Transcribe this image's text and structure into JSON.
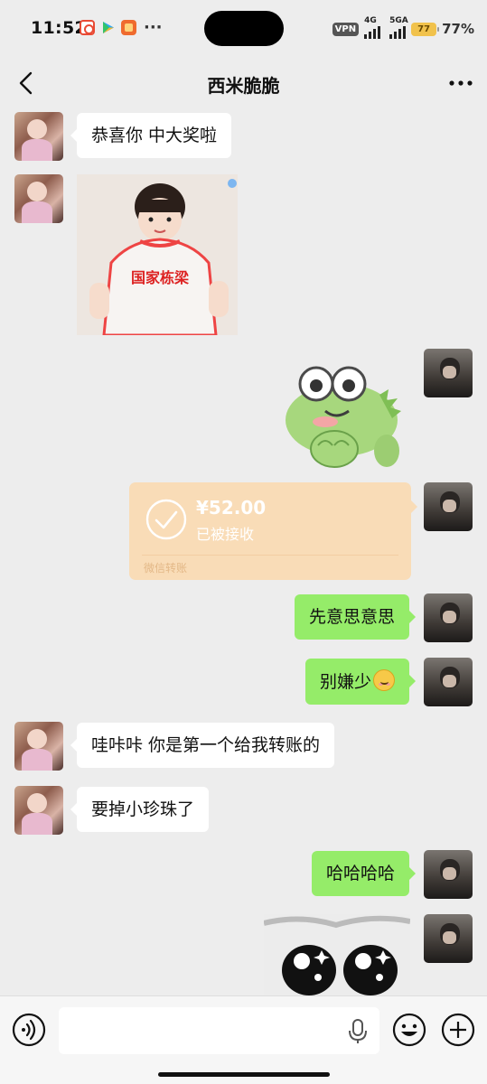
{
  "status_bar": {
    "time": "11:52",
    "more": "···",
    "vpn": "VPN",
    "net1": "4G",
    "net2": "5GA",
    "battery_level": "77",
    "battery_pct": "77%"
  },
  "nav": {
    "title": "西米脆脆"
  },
  "messages": [
    {
      "side": "left",
      "type": "text",
      "text": "恭喜你 中大奖啦"
    },
    {
      "side": "left",
      "type": "sticker",
      "sticker_text": "国家栋梁"
    },
    {
      "side": "right",
      "type": "sticker",
      "sticker": "frog"
    },
    {
      "side": "right",
      "type": "transfer",
      "amount": "¥52.00",
      "status": "已被接收",
      "brand": "微信转账"
    },
    {
      "side": "right",
      "type": "text",
      "text": "先意思意思"
    },
    {
      "side": "right",
      "type": "text",
      "text": "别嫌少"
    },
    {
      "side": "left",
      "type": "text",
      "text": "哇咔咔 你是第一个给我转账的"
    },
    {
      "side": "left",
      "type": "text",
      "text": "要掉小珍珠了"
    },
    {
      "side": "right",
      "type": "text",
      "text": "哈哈哈哈"
    },
    {
      "side": "right",
      "type": "sticker",
      "sticker": "eyes"
    }
  ],
  "input": {
    "value": "",
    "placeholder": ""
  },
  "colors": {
    "background": "#ededed",
    "bubble_self": "#95ec69",
    "bubble_other": "#ffffff",
    "transfer_card": "#f9dcb7"
  },
  "icons": [
    "back-arrow-icon",
    "more-icon",
    "voice-icon",
    "microphone-icon",
    "emoji-icon",
    "plus-icon",
    "check-circle-icon"
  ]
}
